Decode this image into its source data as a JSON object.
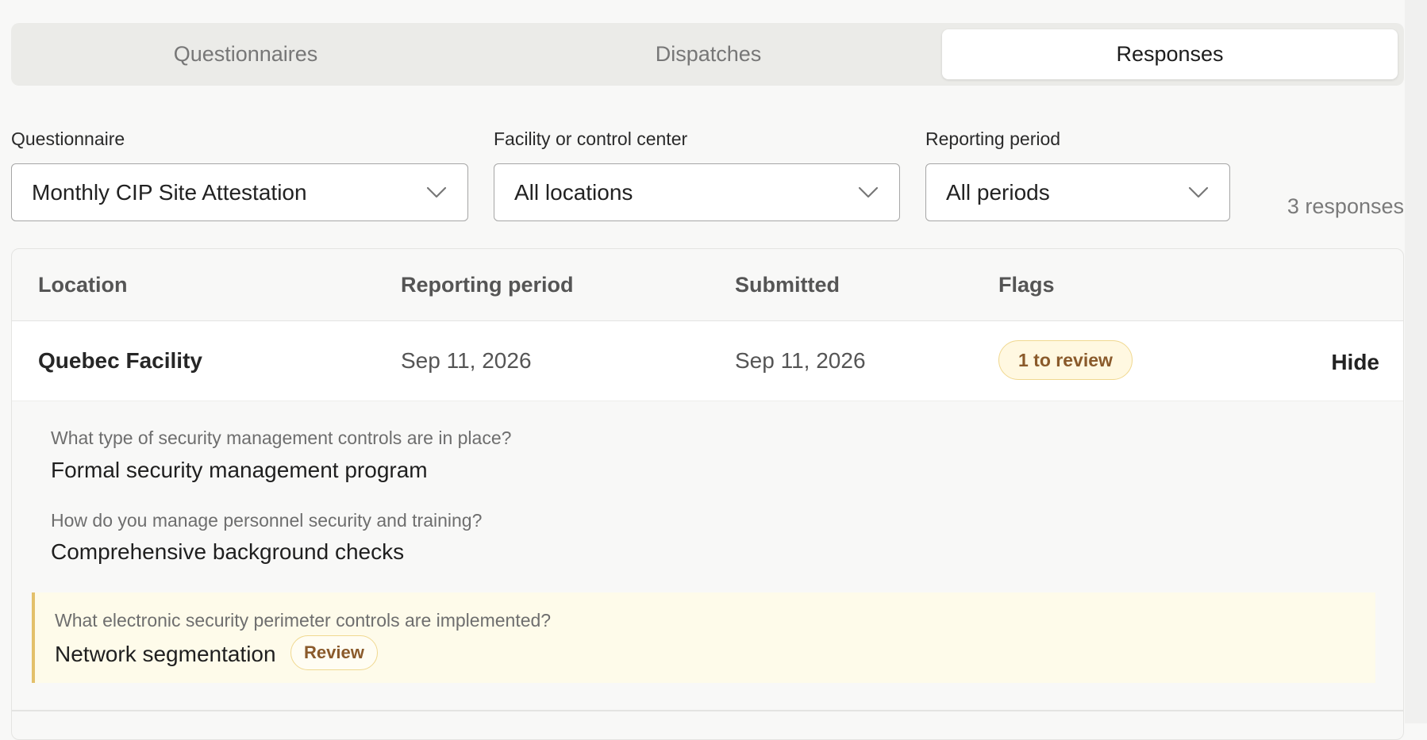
{
  "tabs": [
    "Questionnaires",
    "Dispatches",
    "Responses"
  ],
  "active_tab": "Responses",
  "filters": {
    "questionnaire": {
      "label": "Questionnaire",
      "value": "Monthly CIP Site Attestation"
    },
    "facility": {
      "label": "Facility or control center",
      "value": "All locations"
    },
    "period": {
      "label": "Reporting period",
      "value": "All periods"
    }
  },
  "response_count": "3 responses",
  "table": {
    "headers": [
      "Location",
      "Reporting period",
      "Submitted",
      "Flags"
    ],
    "rows": [
      {
        "location": "Quebec Facility",
        "reporting_period": "Sep 11, 2026",
        "submitted": "Sep 11, 2026",
        "flag": "1 to review",
        "toggle": "Hide",
        "answers": [
          {
            "question": "What type of security management controls are in place?",
            "answer": "Formal security management program"
          },
          {
            "question": "How do you manage personnel security and training?",
            "answer": "Comprehensive background checks"
          },
          {
            "question": "What electronic security perimeter controls are implemented?",
            "answer": "Network segmentation",
            "review": "Review"
          }
        ]
      }
    ]
  },
  "colors": {
    "active_tab_bg": "#ffffff",
    "tabs_bg": "#ebebe8",
    "flag_bg": "#fff8e1",
    "flag_text": "#8a5a2b",
    "flagged_row_bg": "#fefbea",
    "flag_accent": "#e3c06a"
  }
}
